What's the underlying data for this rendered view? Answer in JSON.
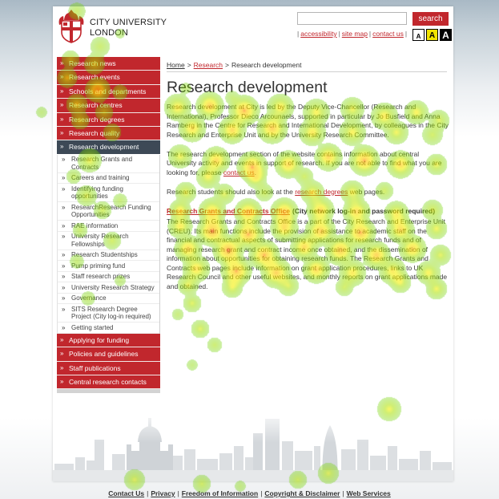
{
  "header": {
    "logo_line1": "CITY UNIVERSITY",
    "logo_line2": "LONDON",
    "search": {
      "value": "",
      "button_label": "search"
    },
    "separator": "|",
    "utility_links": [
      "accessibility",
      "site map",
      "contact us"
    ],
    "text_size_buttons": [
      "A",
      "A",
      "A"
    ]
  },
  "sidebar": {
    "bullet": "»",
    "primary_items": [
      "Research news",
      "Research events",
      "Schools and departments",
      "Research centres",
      "Research degrees",
      "Research quality"
    ],
    "active_item": "Research development",
    "sub_items": [
      "Research Grants and Contracts",
      "Careers and training",
      "Identifying funding opportunities",
      "ResearchResearch Funding Opportunities",
      "RAE information",
      "University Research Fellowships",
      "Research Studentships",
      "Pump priming fund",
      "Staff research prizes",
      "University Research Strategy",
      "Governance",
      "SITS Research Degree Project (City log-in required)",
      "Getting started"
    ],
    "secondary_items": [
      "Applying for funding",
      "Policies and guidelines",
      "Staff publications",
      "Central research contacts"
    ]
  },
  "breadcrumb": {
    "separator": ">",
    "items": [
      "Home",
      "Research",
      "Research development"
    ]
  },
  "main": {
    "title": "Research development",
    "intro": "Research development at City is led by the Deputy Vice-Chancellor (Research and International), Professor Dieco Arcounaels, supported in particular by Jo Busfield and Anna Ramberg in the Centre for Research and International Development, by colleagues in the City Research and Enterprise Unit and by the University Research Committee.",
    "section_before": "The research development section of the website contains information about central University activity and events in support of research. If you are not able to find what you are looking for, please ",
    "section_link": "contact us",
    "section_after": ".",
    "students_before": "Research students should also look at the ",
    "students_link": "research degrees",
    "students_after": " web pages.",
    "grants_heading_link": "Research Grants and Contracts Office",
    "grants_heading_note": "(City network log-in and password required)",
    "grants_text": "The Research Grants and Contracts Office is a part of the City Research and Enterprise Unit (CREU). Its main functions include the provision of assistance to academic staff on the financial and contractual aspects of submitting applications for research funds and of managing research grant and contract income once obtained, and the dissemination of information about opportunities for obtaining research funds. The Research Grants and Contracts web pages include information on grant application procedures, links to UK Research Council and other useful websites, and monthly reports on grant applications made and obtained."
  },
  "footer": {
    "separator": "|",
    "links": [
      "Contact Us",
      "Privacy",
      "Freedom of Information",
      "Copyright & Disclaimer",
      "Web Services"
    ]
  },
  "colors": {
    "brand_red": "#c1272d",
    "active_nav": "#3d4956",
    "body_text": "#3b3b3b",
    "text_size_highlight": "#f1e400"
  },
  "icons": {
    "nav_bullet": "chevron-double-right-icon",
    "logo": "university-crest-icon"
  }
}
